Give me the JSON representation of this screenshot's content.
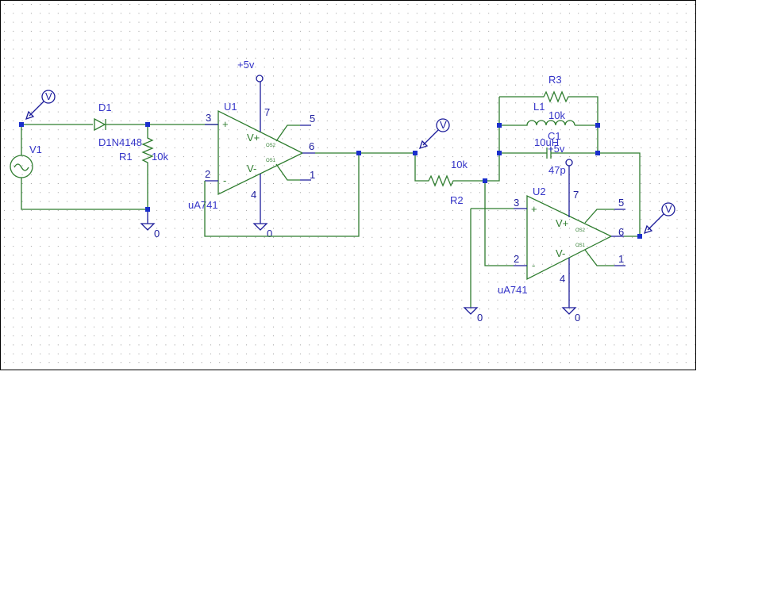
{
  "colors": {
    "wire": "#2f7d2f",
    "pin": "#1c1c9a",
    "label": "#3535c8",
    "node": "#1a2fcc"
  },
  "source": {
    "name": "V1"
  },
  "diode": {
    "name": "D1",
    "model": "D1N4148"
  },
  "r1": {
    "name": "R1",
    "value": "10k"
  },
  "r2": {
    "name": "R2",
    "value": "10k"
  },
  "r3": {
    "name": "R3",
    "value": "10k"
  },
  "l1": {
    "name": "L1",
    "value": "10uH"
  },
  "c1": {
    "name": "C1",
    "value": "47p"
  },
  "u1": {
    "name": "U1",
    "model": "uA741",
    "vplus": "V+",
    "vminus": "V-",
    "os2": "OS2",
    "os1": "OS1",
    "pin_plus": "+",
    "pin_minus": "-",
    "supply": "+5v",
    "pins": {
      "p3": "3",
      "p2": "2",
      "p7": "7",
      "p4": "4",
      "p5": "5",
      "p1": "1",
      "p6": "6"
    }
  },
  "u2": {
    "name": "U2",
    "model": "uA741",
    "vplus": "V+",
    "vminus": "V-",
    "os2": "OS2",
    "os1": "OS1",
    "pin_plus": "+",
    "pin_minus": "-",
    "supply": "+5v",
    "pins": {
      "p3": "3",
      "p2": "2",
      "p7": "7",
      "p4": "4",
      "p5": "5",
      "p1": "1",
      "p6": "6"
    }
  },
  "ground_label": "0",
  "probe_label": "V"
}
